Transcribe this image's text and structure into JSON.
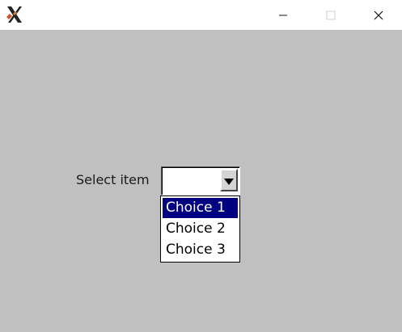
{
  "window": {
    "app_icon": "x-logo-icon",
    "controls": {
      "minimize_icon": "minimize-icon",
      "maximize_icon": "maximize-icon",
      "close_icon": "close-icon"
    }
  },
  "form": {
    "label": "Select item",
    "combobox": {
      "value": "",
      "arrow_icon": "triangle-down-icon",
      "options": [
        "Choice 1",
        "Choice 2",
        "Choice 3"
      ],
      "highlighted_option": "Choice 1"
    }
  },
  "colors": {
    "background": "#c0c0c0",
    "highlight": "#000080",
    "highlight_text": "#ffffff"
  }
}
